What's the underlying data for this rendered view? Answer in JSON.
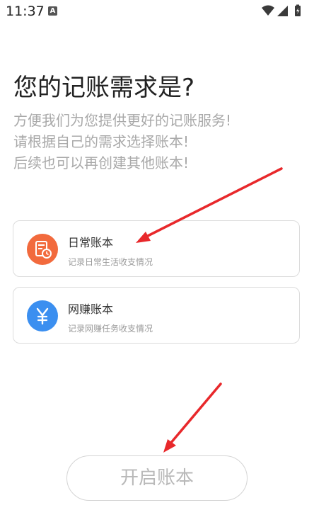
{
  "status_bar": {
    "time": "11:37",
    "a_badge": "A",
    "icons": [
      "wifi-icon",
      "signal-icon",
      "battery-icon"
    ]
  },
  "page": {
    "title": "您的记账需求是?",
    "subtitle_lines": [
      "方便我们为您提供更好的记账服务!",
      "请根据自己的需求选择账本!",
      "后续也可以再创建其他账本!"
    ]
  },
  "options": [
    {
      "name": "日常账本",
      "desc": "记录日常生活收支情况",
      "icon": "ledger-clock-icon",
      "color": "#f26a3d"
    },
    {
      "name": "网赚账本",
      "desc": "记录网赚任务收支情况",
      "icon": "yen-icon",
      "color": "#3b8ff0"
    }
  ],
  "open_button": {
    "label": "开启账本"
  },
  "colors": {
    "annotation_arrow": "#e8282b"
  }
}
